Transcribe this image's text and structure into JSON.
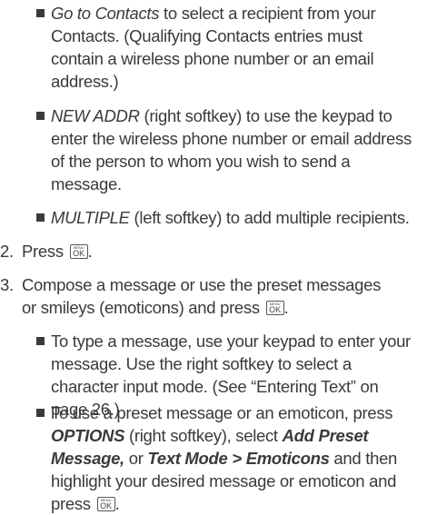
{
  "bullets_top": [
    {
      "lead": "Go to Contacts",
      "lines": [
        " to select a recipient from your",
        "Contacts. (Qualifying Contacts entries must",
        "contain a wireless phone number or an email",
        "address.)"
      ]
    },
    {
      "lead": "NEW ADDR",
      "lines": [
        " (right softkey) to use the keypad to",
        "enter the wireless phone number or email address",
        "of the person to whom you wish to send a",
        "message."
      ]
    },
    {
      "lead": "MULTIPLE",
      "lines": [
        " (left softkey) to add multiple recipients."
      ]
    }
  ],
  "steps": [
    {
      "number": "2.",
      "lines": [
        "Press "
      ]
    },
    {
      "number": "3.",
      "lines": [
        "Compose a message or use the preset messages",
        "or smileys (emoticons) and press "
      ]
    }
  ],
  "key_label": {
    "top": "MENU",
    "main": "OK"
  },
  "bullets_bottom": [
    {
      "lines": [
        "To type a message, use your keypad to enter your",
        "message. Use the right softkey to select a",
        "character input mode. (See “Entering Text” on",
        "page 26.)"
      ]
    },
    {
      "line1": "To use a preset  message or an emoticon, press",
      "line2_lead": "OPTIONS",
      "line2_rest": " (right softkey), select ",
      "line2_bold": "Add Preset",
      "line3_bold": "Message,",
      "line3_mid": " or ",
      "line3_bold2": "Text Mode",
      "line3_sep": " > ",
      "line3_bold3": "Emoticons",
      "line3_rest": " and then",
      "line4": "highlight your desired message or emoticon and",
      "line5": "press "
    }
  ]
}
